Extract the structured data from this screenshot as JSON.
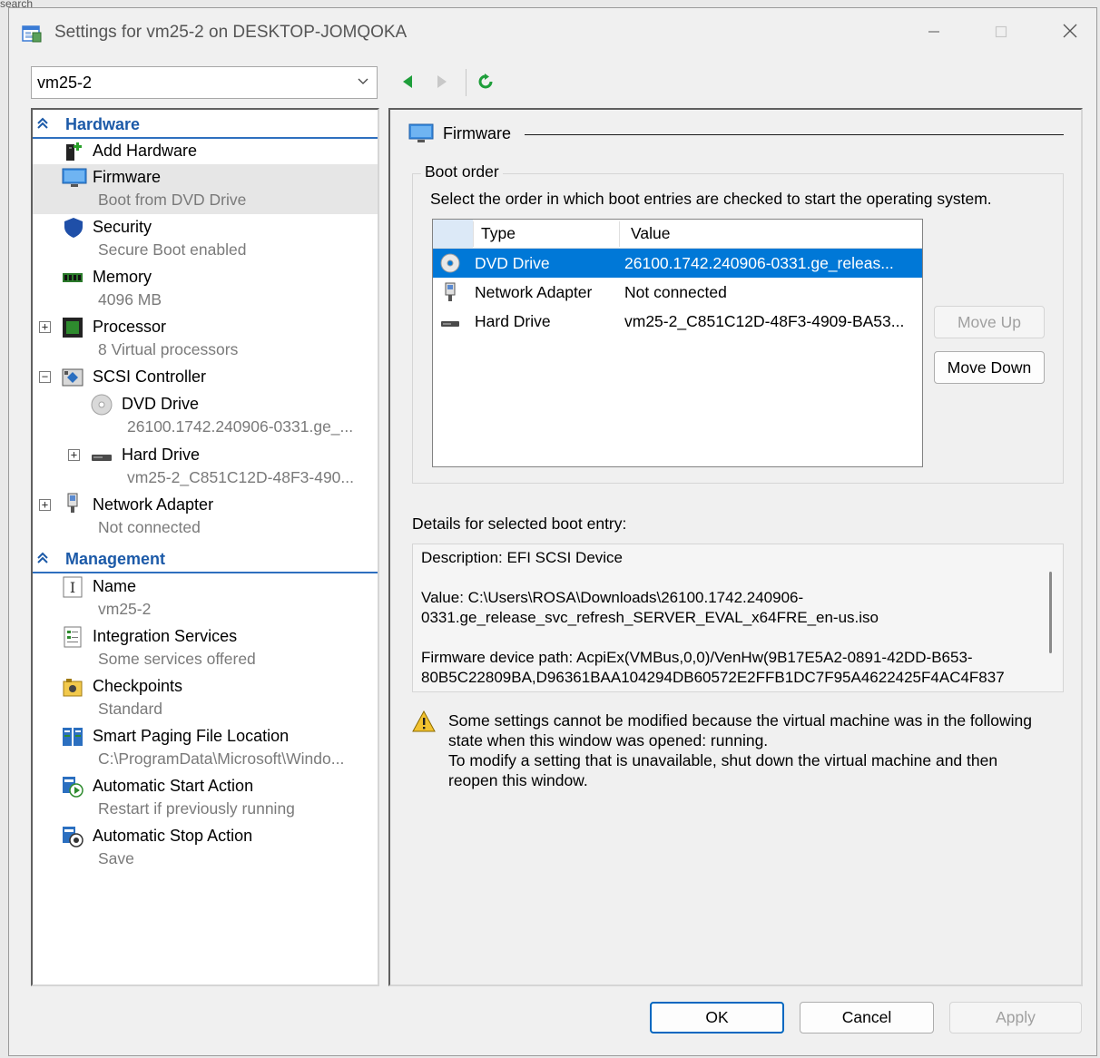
{
  "window": {
    "title": "Settings for vm25-2 on DESKTOP-JOMQOKA",
    "background_fragment": "search"
  },
  "toolbar": {
    "vm_selector": "vm25-2"
  },
  "tree": {
    "hardware_header": "Hardware",
    "management_header": "Management",
    "items": [
      {
        "label": "Add Hardware",
        "sub": ""
      },
      {
        "label": "Firmware",
        "sub": "Boot from DVD Drive"
      },
      {
        "label": "Security",
        "sub": "Secure Boot enabled"
      },
      {
        "label": "Memory",
        "sub": "4096 MB"
      },
      {
        "label": "Processor",
        "sub": "8 Virtual processors"
      },
      {
        "label": "SCSI Controller",
        "sub": ""
      },
      {
        "label": "DVD Drive",
        "sub": "26100.1742.240906-0331.ge_..."
      },
      {
        "label": "Hard Drive",
        "sub": "vm25-2_C851C12D-48F3-490..."
      },
      {
        "label": "Network Adapter",
        "sub": "Not connected"
      },
      {
        "label": "Name",
        "sub": "vm25-2"
      },
      {
        "label": "Integration Services",
        "sub": "Some services offered"
      },
      {
        "label": "Checkpoints",
        "sub": "Standard"
      },
      {
        "label": "Smart Paging File Location",
        "sub": "C:\\ProgramData\\Microsoft\\Windo..."
      },
      {
        "label": "Automatic Start Action",
        "sub": "Restart if previously running"
      },
      {
        "label": "Automatic Stop Action",
        "sub": "Save"
      }
    ]
  },
  "firmware": {
    "title": "Firmware",
    "boot_order_title": "Boot order",
    "boot_order_desc": "Select the order in which boot entries are checked to start the operating system.",
    "columns": [
      "Type",
      "Value"
    ],
    "boot_entries": [
      {
        "type": "DVD Drive",
        "value": "26100.1742.240906-0331.ge_releas..."
      },
      {
        "type": "Network Adapter",
        "value": "Not connected"
      },
      {
        "type": "Hard Drive",
        "value": "vm25-2_C851C12D-48F3-4909-BA53..."
      }
    ],
    "move_up": "Move Up",
    "move_down": "Move Down",
    "details_label": "Details for selected boot entry:",
    "details": [
      "Description: EFI SCSI Device",
      "Value: C:\\Users\\ROSA\\Downloads\\26100.1742.240906-",
      "0331.ge_release_svc_refresh_SERVER_EVAL_x64FRE_en-us.iso",
      "Firmware device path: AcpiEx(VMBus,0,0)/VenHw(9B17E5A2-0891-42DD-B653-",
      "80B5C22809BA,D96361BAA104294DB60572E2FFB1DC7F95A4622425F4AC4F837"
    ],
    "warning": [
      "Some settings cannot be modified because the virtual machine was in the following",
      "state when this window was opened: running.",
      "To modify a setting that is unavailable, shut down the virtual machine and then",
      "reopen this window."
    ]
  },
  "buttons": {
    "ok": "OK",
    "cancel": "Cancel",
    "apply": "Apply"
  },
  "colors": {
    "selection": "#0078d7",
    "section_header": "#1c5aa8",
    "nav_arrow": "#1e9e3a"
  }
}
